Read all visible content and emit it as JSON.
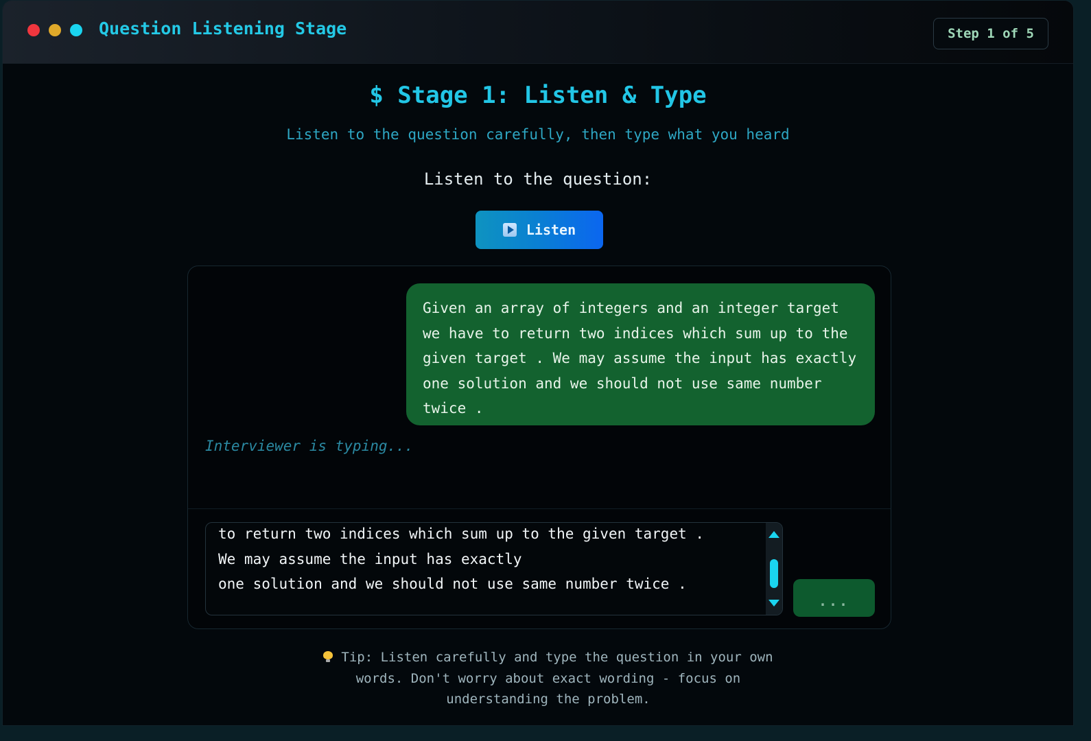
{
  "window": {
    "title": "Question Listening Stage",
    "step": "Step 1 of 5"
  },
  "stage": {
    "heading": "$ Stage 1: Listen & Type",
    "subtitle": "Listen to the question carefully, then type what you heard",
    "listen_label": "Listen to the question:",
    "listen_button": "Listen"
  },
  "chat": {
    "message": "Given an array of integers and an integer target we have to return two indices which sum up to the given target . We may assume the input has exactly one solution and we should not use same number twice .",
    "typing_indicator": "Interviewer is typing...",
    "input_value": "to return two indices which sum up to the given target .\nWe may assume the input has exactly\none solution and we should not use same number twice .",
    "send_button": "..."
  },
  "tip": {
    "text": "Tip: Listen carefully and type the question in your own words. Don't worry about exact wording - focus on understanding the problem."
  },
  "colors": {
    "accent": "#22c6e6",
    "bubble": "#13622f",
    "button_gradient_start": "#0e93c0",
    "button_gradient_end": "#0b66f0",
    "send_button": "#0d5a2e"
  },
  "icons": [
    "close-dot",
    "minimize-dot",
    "maximize-dot",
    "play-icon",
    "chevron-up-icon",
    "chevron-down-icon",
    "lightbulb-icon"
  ]
}
